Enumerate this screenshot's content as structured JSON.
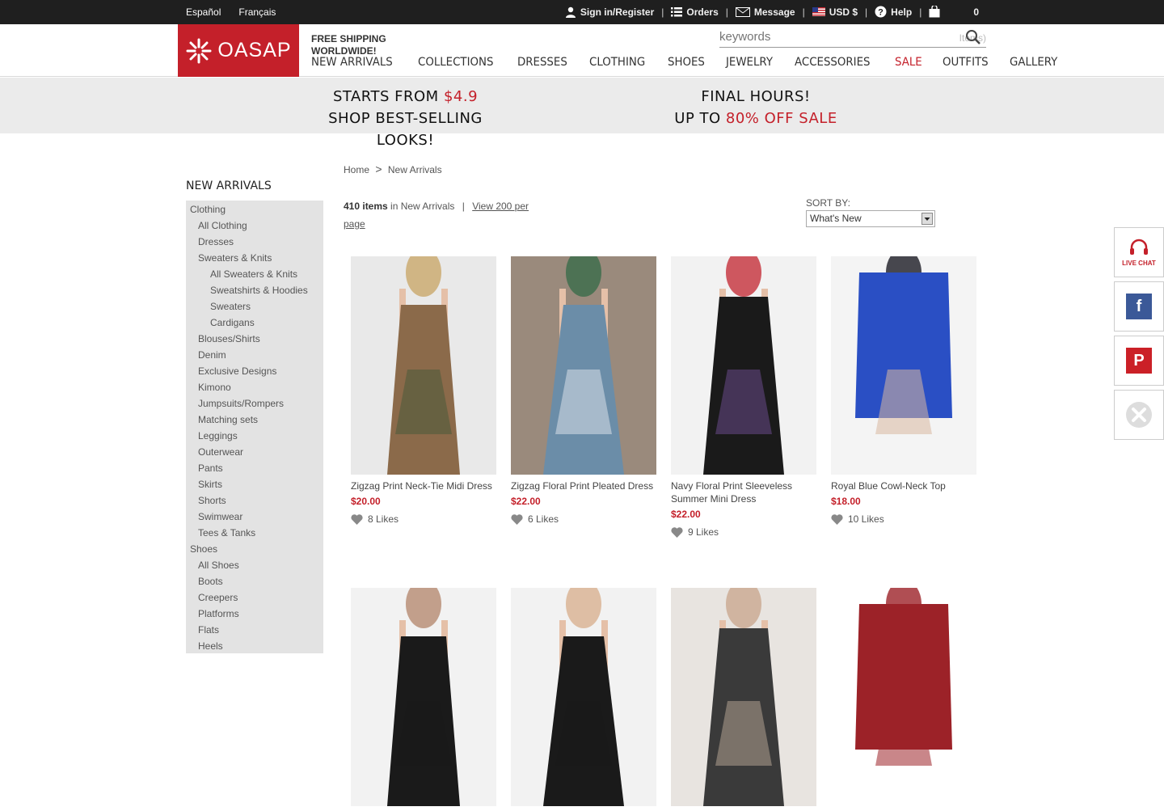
{
  "topbar": {
    "languages": [
      "Español",
      "Français"
    ],
    "signin": "Sign in/Register",
    "orders": "Orders",
    "message": "Message",
    "currency": "USD $",
    "help": "Help",
    "cart_count": "0"
  },
  "header": {
    "logo_text": "OASAP",
    "free_shipping": "FREE SHIPPING WORLDWIDE!",
    "search_placeholder": "keywords",
    "search_items_text": "Items)",
    "nav": [
      "NEW ARRIVALS",
      "COLLECTIONS",
      "DRESSES",
      "CLOTHING",
      "SHOES",
      "JEWELRY",
      "ACCESSORIES",
      "SALE",
      "OUTFITS",
      "GALLERY"
    ]
  },
  "banner": {
    "left_line1_prefix": "STARTS FROM ",
    "left_line1_highlight": "$4.9",
    "left_line2": "SHOP BEST-SELLING LOOKS!",
    "right_line1": "FINAL HOURS!",
    "right_line2_prefix": "UP TO ",
    "right_line2_highlight": "80% OFF SALE"
  },
  "sidebar": {
    "title": "NEW ARRIVALS",
    "items": [
      {
        "label": "Clothing",
        "level": 0
      },
      {
        "label": "All Clothing",
        "level": 1
      },
      {
        "label": "Dresses",
        "level": 1
      },
      {
        "label": "Sweaters & Knits",
        "level": 1
      },
      {
        "label": "All Sweaters & Knits",
        "level": 2
      },
      {
        "label": "Sweatshirts & Hoodies",
        "level": 2
      },
      {
        "label": "Sweaters",
        "level": 2
      },
      {
        "label": "Cardigans",
        "level": 2
      },
      {
        "label": "Blouses/Shirts",
        "level": 1
      },
      {
        "label": "Denim",
        "level": 1
      },
      {
        "label": "Exclusive Designs",
        "level": 1
      },
      {
        "label": "Kimono",
        "level": 1
      },
      {
        "label": "Jumpsuits/Rompers",
        "level": 1
      },
      {
        "label": "Matching sets",
        "level": 1
      },
      {
        "label": "Leggings",
        "level": 1
      },
      {
        "label": "Outerwear",
        "level": 1
      },
      {
        "label": "Pants",
        "level": 1
      },
      {
        "label": "Skirts",
        "level": 1
      },
      {
        "label": "Shorts",
        "level": 1
      },
      {
        "label": "Swimwear",
        "level": 1
      },
      {
        "label": "Tees & Tanks",
        "level": 1
      },
      {
        "label": "Shoes",
        "level": 0
      },
      {
        "label": "All Shoes",
        "level": 1
      },
      {
        "label": "Boots",
        "level": 1
      },
      {
        "label": "Creepers",
        "level": 1
      },
      {
        "label": "Platforms",
        "level": 1
      },
      {
        "label": "Flats",
        "level": 1
      },
      {
        "label": "Heels",
        "level": 1
      }
    ]
  },
  "breadcrumb": {
    "home": "Home",
    "sep": ">",
    "current": "New Arrivals"
  },
  "listing": {
    "count_bold": "410 items",
    "count_rest": " in New Arrivals",
    "view_link": "View 200 per page",
    "sort_label": "SORT BY:",
    "sort_value": "What's New"
  },
  "products": [
    {
      "name": "Zigzag Print Neck-Tie Midi Dress",
      "price": "$20.00",
      "likes": "8 Likes",
      "colors": [
        "#e9e9e9",
        "#8b6a4a",
        "#c9a86a",
        "#4b5a3a"
      ]
    },
    {
      "name": "Zigzag Floral Print Pleated Dress",
      "price": "$22.00",
      "likes": "6 Likes",
      "colors": [
        "#9a8a7c",
        "#6b8da8",
        "#3a6b4a",
        "#d8e0e8"
      ]
    },
    {
      "name": "Navy Floral Print Sleeveless Summer Mini Dress",
      "price": "$22.00",
      "likes": "9 Likes",
      "colors": [
        "#f2f2f2",
        "#1a1a1a",
        "#c4303a",
        "#6a4a8a"
      ]
    },
    {
      "name": "Royal Blue Cowl-Neck Top",
      "price": "$18.00",
      "likes": "10 Likes",
      "colors": [
        "#f4f4f4",
        "#2a4fc4",
        "#1c1c24",
        "#d9b8a0"
      ]
    },
    {
      "name": "",
      "price": "",
      "likes": "",
      "colors": [
        "#f2f2f2",
        "#1a1a1a",
        "#b58a70",
        "#1a1a1a"
      ]
    },
    {
      "name": "",
      "price": "",
      "likes": "",
      "colors": [
        "#f2f2f2",
        "#1a1a1a",
        "#d8b090",
        "#1a1a1a"
      ]
    },
    {
      "name": "",
      "price": "",
      "likes": "",
      "colors": [
        "#e8e4e0",
        "#3a3a3a",
        "#c9a890",
        "#b0a090"
      ]
    },
    {
      "name": "",
      "price": "",
      "likes": "",
      "colors": [
        "#ffffff",
        "#9c2228",
        "#9c2228",
        "#9c2228"
      ]
    }
  ],
  "social": {
    "live_chat": "LIVE CHAT"
  },
  "colors": {
    "brand_red": "#c4202a",
    "facebook": "#3b5998",
    "pinterest": "#cb2027"
  }
}
